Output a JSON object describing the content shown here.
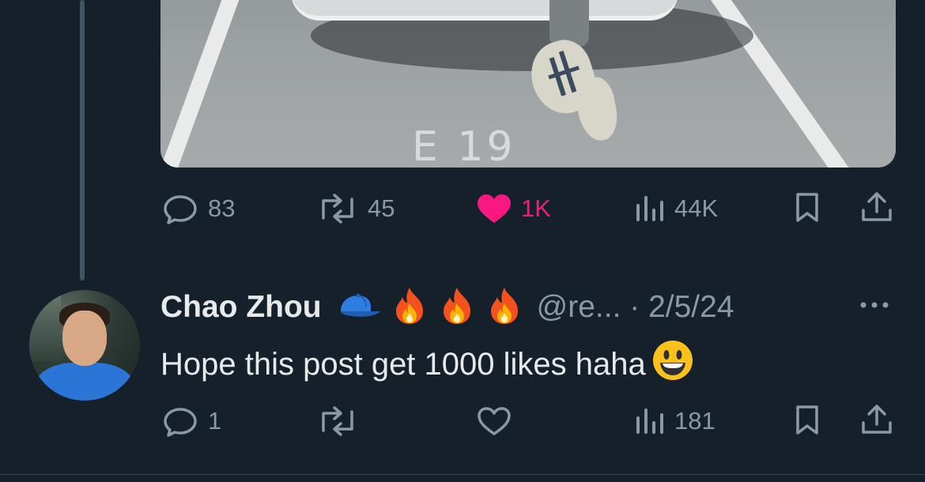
{
  "post": {
    "media": {
      "floor_text": "E 19"
    },
    "actions": {
      "replies": "83",
      "reposts": "45",
      "likes": "1K",
      "views": "44K"
    }
  },
  "reply": {
    "display_name": "Chao Zhou",
    "badges": [
      "cap-emoji",
      "fire-emoji",
      "fire-emoji",
      "fire-emoji"
    ],
    "handle_date": "@re... · 2/5/24",
    "text": "Hope this post get 1000 likes haha",
    "trailing_emoji": "grinning-face-emoji",
    "actions": {
      "replies": "1",
      "reposts": "",
      "likes": "",
      "views": "181"
    }
  },
  "colors": {
    "background": "#15202b",
    "text_primary": "#e7e9ea",
    "text_secondary": "#8b98a5",
    "like_pink": "#f91880",
    "thread_line": "#425364"
  }
}
